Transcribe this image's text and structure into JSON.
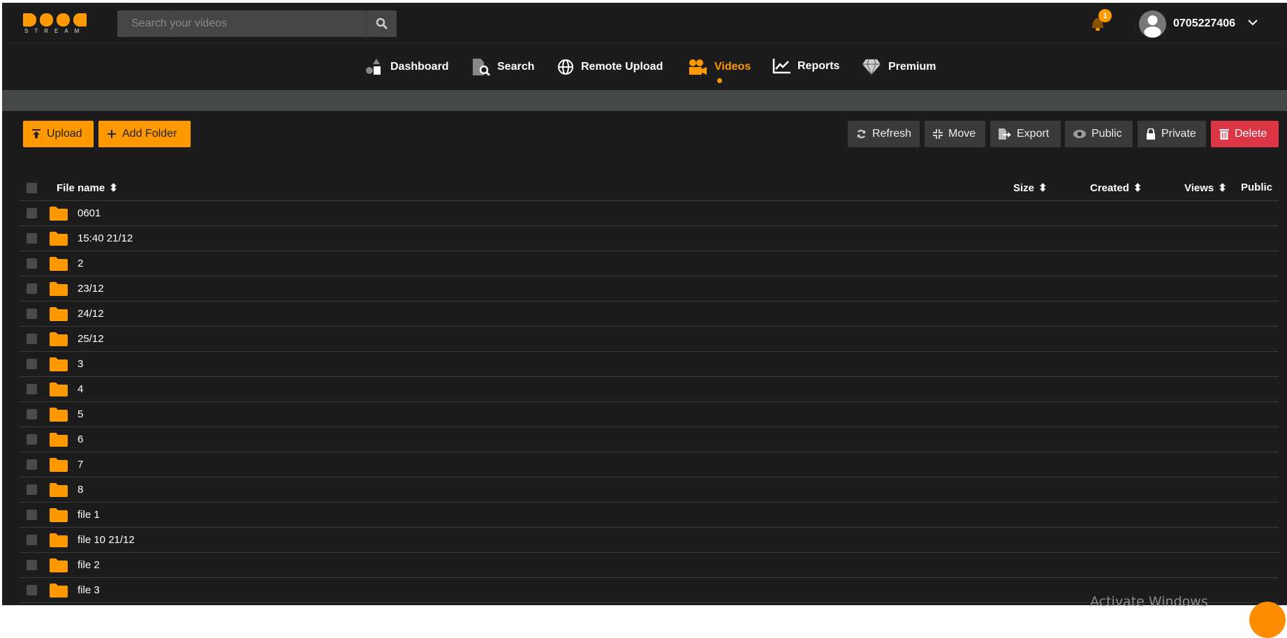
{
  "header": {
    "logo_text": "DOOD STREAM",
    "logo_word": "STREAM",
    "search_placeholder": "Search your videos",
    "notification_count": "1",
    "username": "0705227406"
  },
  "nav": [
    {
      "label": "Dashboard",
      "icon": "dashboard-shapes-icon"
    },
    {
      "label": "Search",
      "icon": "file-search-icon"
    },
    {
      "label": "Remote Upload",
      "icon": "globe-icon"
    },
    {
      "label": "Videos",
      "icon": "video-camera-icon",
      "active": true
    },
    {
      "label": "Reports",
      "icon": "chart-icon"
    },
    {
      "label": "Premium",
      "icon": "diamond-icon"
    }
  ],
  "toolbar": {
    "upload": "Upload",
    "add_folder": "Add Folder",
    "refresh": "Refresh",
    "move": "Move",
    "export": "Export",
    "public": "Public",
    "private": "Private",
    "delete": "Delete"
  },
  "table": {
    "columns": {
      "file_name": "File name",
      "size": "Size",
      "created": "Created",
      "views": "Views",
      "public": "Public"
    },
    "rows": [
      "0601",
      "15:40 21/12",
      "2",
      "23/12",
      "24/12",
      "25/12",
      "3",
      "4",
      "5",
      "6",
      "7",
      "8",
      "file 1",
      "file 10 21/12",
      "file 2",
      "file 3"
    ]
  },
  "colors": {
    "accent": "#ff9900",
    "danger": "#dc3545",
    "background": "#1c1c1c"
  },
  "watermark": "Activate Windows"
}
